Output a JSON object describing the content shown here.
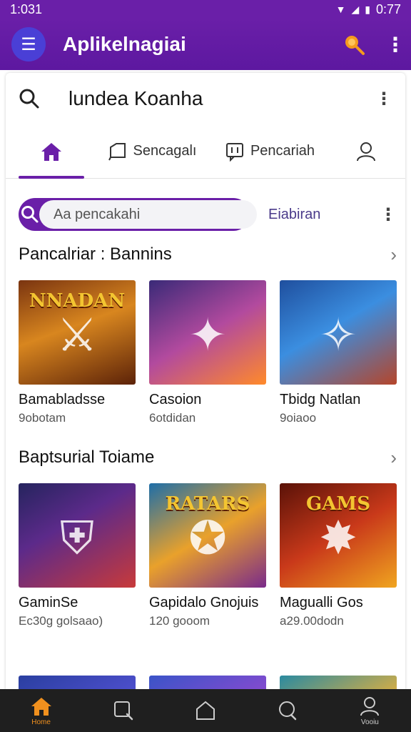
{
  "status_bar": {
    "time": "1:031",
    "battery": "0:77"
  },
  "app_bar": {
    "title": "Aplikelnagiai"
  },
  "search_header": {
    "title": "lundea Koanha"
  },
  "tabs": [
    {
      "label": "",
      "icon": "home-icon",
      "active": true
    },
    {
      "label": "Sencagalı",
      "icon": "tag-icon",
      "active": false
    },
    {
      "label": "Pencariah",
      "icon": "chat-icon",
      "active": false
    },
    {
      "label": "",
      "icon": "profile-icon",
      "active": false
    }
  ],
  "search": {
    "placeholder": "Aa pencakahi",
    "filter_label": "Eiabiran"
  },
  "sections": [
    {
      "title": "Pancalriar : Bannins",
      "games": [
        {
          "name": "Bamabladsse",
          "meta": "9obotam",
          "banner": "NNADAN"
        },
        {
          "name": "Casoion",
          "meta": "6otdidan",
          "banner": ""
        },
        {
          "name": "Tbidg Natlan",
          "meta": "9oiaoo",
          "banner": ""
        }
      ]
    },
    {
      "title": "Baptsurial Toiame",
      "games": [
        {
          "name": "GaminSe",
          "meta": "Ec30g golsaao)",
          "banner": ""
        },
        {
          "name": "Gapidalo Gnojuis",
          "meta": "120 gooom",
          "banner": "RATARS"
        },
        {
          "name": "Magualli Gos",
          "meta": "a29.00dodn",
          "banner": "GAMS"
        }
      ]
    }
  ],
  "bottom_nav": [
    {
      "label": "Home",
      "icon": "home-icon",
      "active": true
    },
    {
      "label": "",
      "icon": "search-icon",
      "active": false
    },
    {
      "label": "",
      "icon": "house-outline-icon",
      "active": false
    },
    {
      "label": "",
      "icon": "chat-icon",
      "active": false
    },
    {
      "label": "Vooiu",
      "icon": "profile-icon",
      "active": false
    }
  ],
  "colors": {
    "primary": "#6a1fa8",
    "accent": "#f0901e",
    "nav_bg": "#1f1f1f"
  }
}
